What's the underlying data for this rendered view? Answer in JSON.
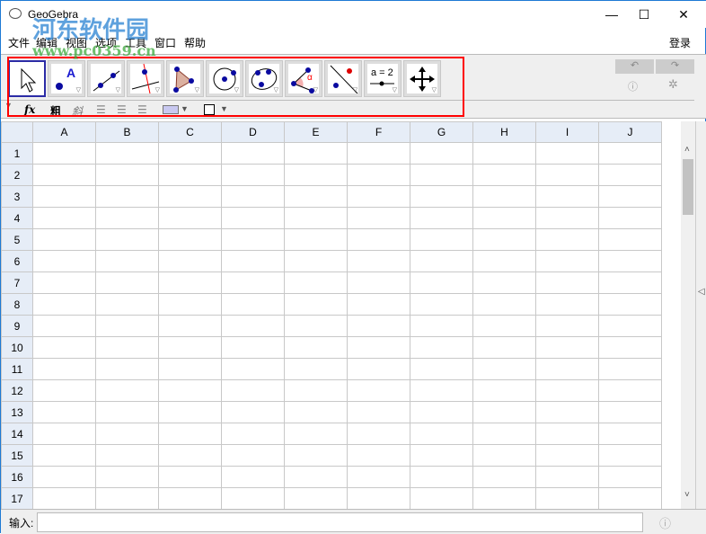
{
  "window": {
    "title": "GeoGebra",
    "minimize": "—",
    "maximize": "☐",
    "close": "✕"
  },
  "menu": [
    "文件",
    "编辑",
    "视图",
    "选项",
    "工具",
    "窗口",
    "帮助"
  ],
  "login": "登录",
  "tools": [
    {
      "name": "move",
      "label": ""
    },
    {
      "name": "point",
      "label": "A"
    },
    {
      "name": "line",
      "label": ""
    },
    {
      "name": "perpendicular",
      "label": ""
    },
    {
      "name": "polygon",
      "label": ""
    },
    {
      "name": "circle",
      "label": ""
    },
    {
      "name": "conic",
      "label": ""
    },
    {
      "name": "angle",
      "label": "α"
    },
    {
      "name": "reflect",
      "label": ""
    },
    {
      "name": "slider",
      "label": "a = 2"
    },
    {
      "name": "move-view",
      "label": ""
    }
  ],
  "stylebar": {
    "fx": "fx",
    "bold": "粗",
    "italic": "斜"
  },
  "columns": [
    "A",
    "B",
    "C",
    "D",
    "E",
    "F",
    "G",
    "H",
    "I",
    "J"
  ],
  "rows": [
    "1",
    "2",
    "3",
    "4",
    "5",
    "6",
    "7",
    "8",
    "9",
    "10",
    "11",
    "12",
    "13",
    "14",
    "15",
    "16",
    "17"
  ],
  "input": {
    "label": "输入:",
    "value": ""
  },
  "watermark": {
    "text": "河东软件园",
    "url": "www.pc0359.cn"
  },
  "colors": {
    "highlight": "#ff0000",
    "header": "#e6edf7",
    "selected_tool": "#2c2ca6"
  }
}
